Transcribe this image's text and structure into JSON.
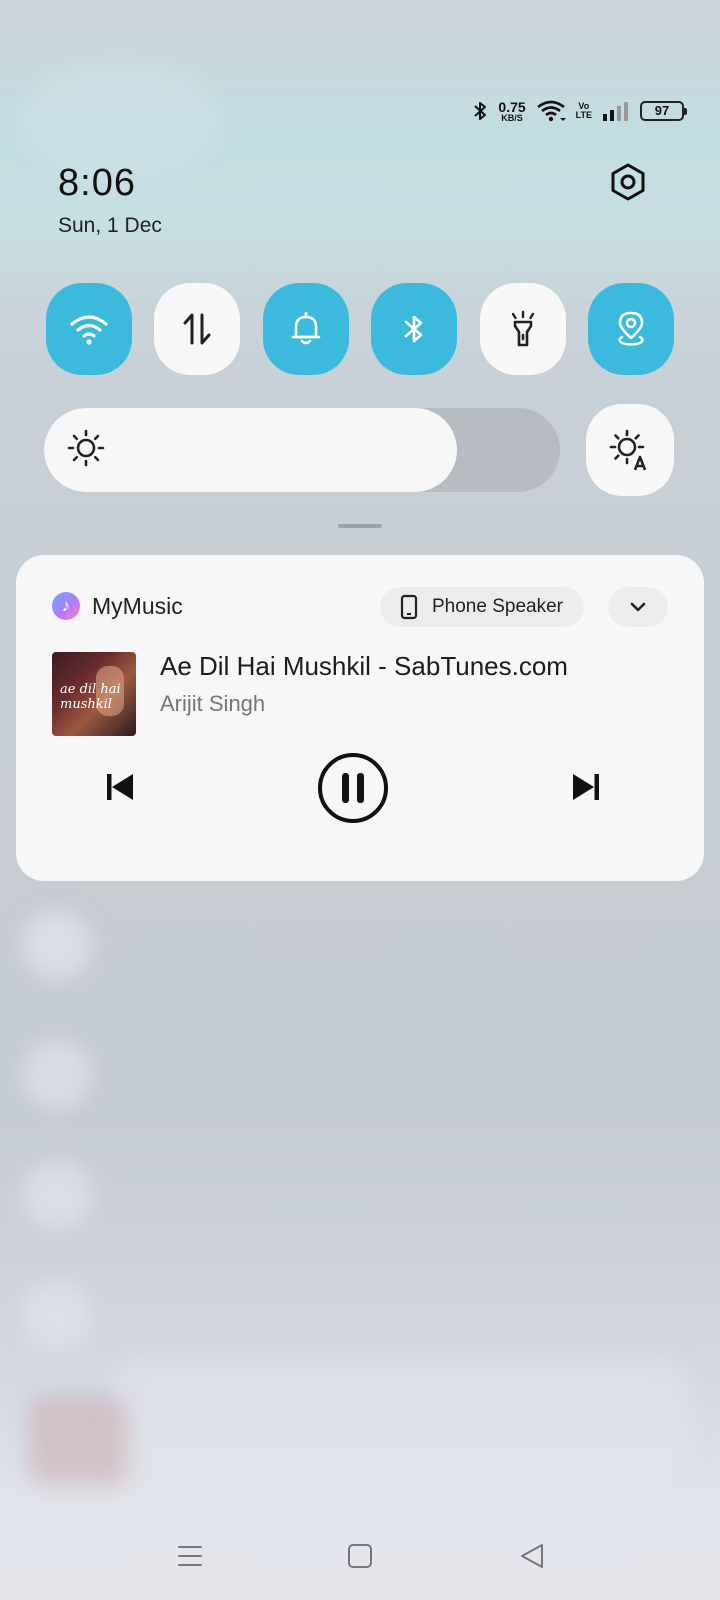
{
  "status_bar": {
    "net_speed": "0.75",
    "net_unit": "KB/S",
    "volte_top": "Vo",
    "volte_bottom": "LTE",
    "battery": "97",
    "icons": [
      "bluetooth-icon",
      "wifi-icon",
      "signal-icon",
      "battery-icon"
    ]
  },
  "header": {
    "time": "8:06",
    "date": "Sun, 1 Dec"
  },
  "quick_tiles": [
    {
      "name": "wifi",
      "icon": "wifi-icon",
      "on": true
    },
    {
      "name": "mobile-data",
      "icon": "data-arrows-icon",
      "on": false
    },
    {
      "name": "sound",
      "icon": "bell-icon",
      "on": true
    },
    {
      "name": "bluetooth",
      "icon": "bluetooth-icon",
      "on": true
    },
    {
      "name": "flashlight",
      "icon": "flashlight-icon",
      "on": false
    },
    {
      "name": "location",
      "icon": "location-icon",
      "on": true
    }
  ],
  "brightness": {
    "level": 0.8,
    "icon": "sun-icon",
    "auto_icon": "auto-brightness-icon"
  },
  "media": {
    "app_name": "MyMusic",
    "output_device": "Phone Speaker",
    "track_title": "Ae Dil Hai Mushkil - SabTunes.com",
    "artist": "Arijit Singh",
    "album_art_text": "ae dil hai mushkil",
    "state": "playing"
  },
  "colors": {
    "tile_on": "#3bbade",
    "tile_off": "#f7f7f7"
  }
}
